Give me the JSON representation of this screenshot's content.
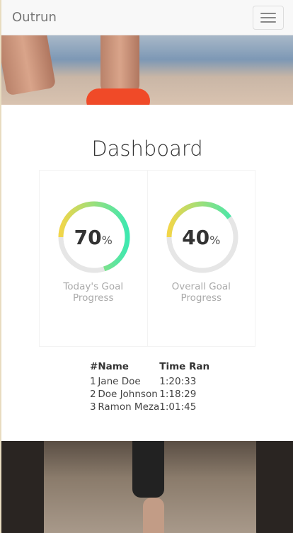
{
  "navbar": {
    "brand": "Outrun",
    "menu_icon": "hamburger-icon"
  },
  "main": {
    "title": "Dashboard",
    "widgets": [
      {
        "value": "70",
        "unit": "%",
        "progress": 0.7,
        "label": "Today's Goal Progress"
      },
      {
        "value": "40",
        "unit": "%",
        "progress": 0.4,
        "label": "Overall Goal Progress"
      }
    ],
    "colors": {
      "ring_start": "#3ee8b0",
      "ring_end": "#f2d649",
      "track": "#e6e6e6"
    },
    "table": {
      "headers": [
        "#",
        "Name",
        "Time Ran"
      ],
      "rows": [
        [
          "1",
          "Jane Doe",
          "1:20:33"
        ],
        [
          "2",
          "Doe Johnson",
          "1:18:29"
        ],
        [
          "3",
          "Ramon Meza",
          "1:01:45"
        ]
      ]
    }
  }
}
